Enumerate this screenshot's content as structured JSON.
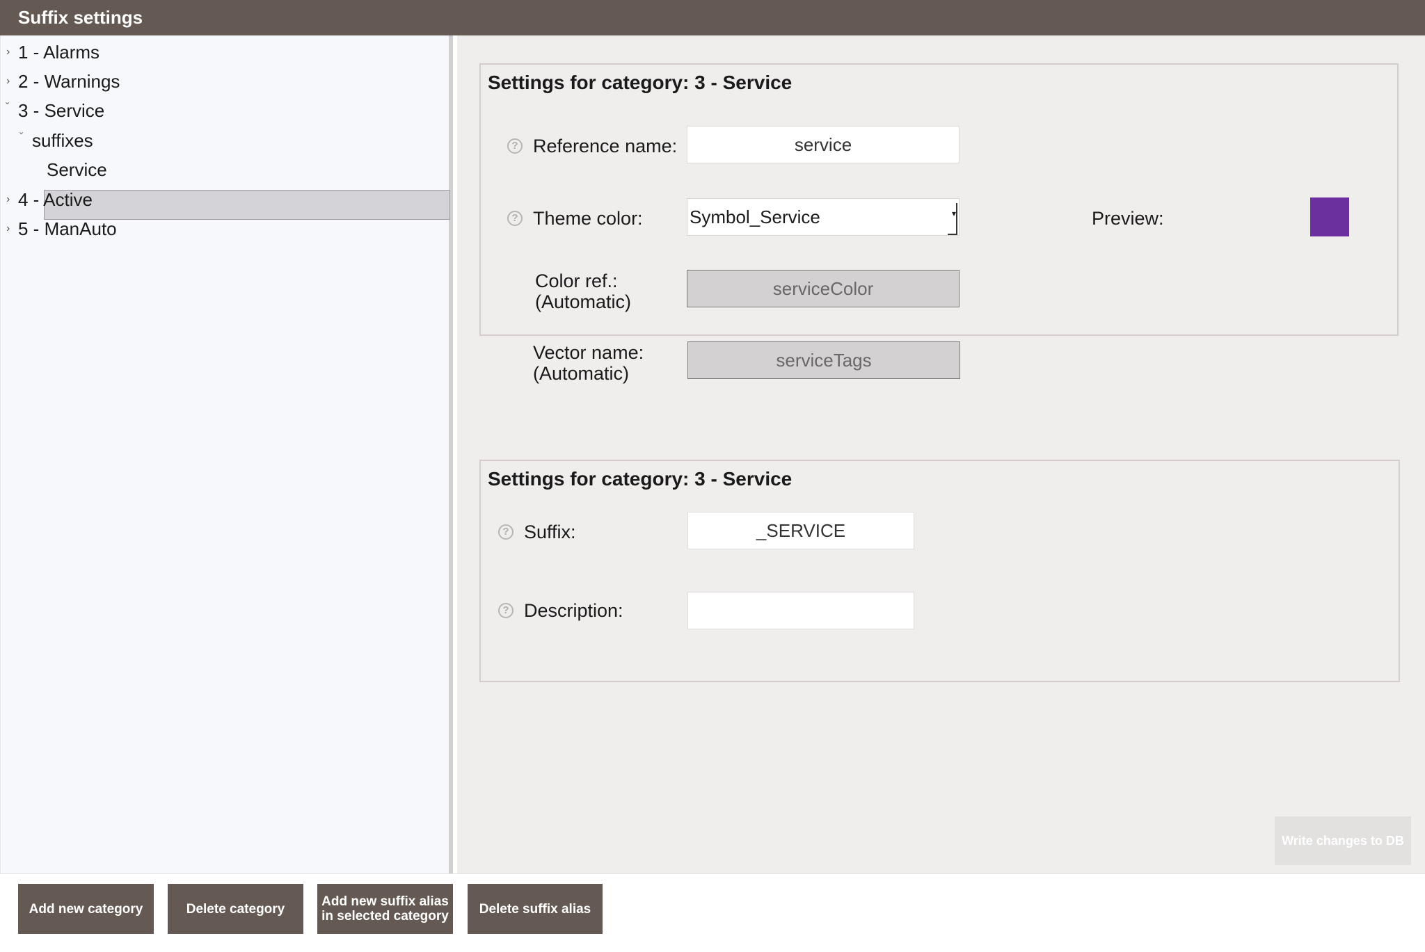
{
  "window": {
    "title": "Suffix settings"
  },
  "tree": {
    "items": [
      {
        "label": "1 - Alarms",
        "expanded": false
      },
      {
        "label": "2 - Warnings",
        "expanded": false
      },
      {
        "label": "3 - Service",
        "expanded": true
      },
      {
        "label": "suffixes",
        "expanded": true
      },
      {
        "label": "Service",
        "selected": true
      },
      {
        "label": "4 - Active",
        "expanded": false
      },
      {
        "label": "5 - ManAuto",
        "expanded": false
      }
    ],
    "collapsed_glyph": "›",
    "expanded_glyph": "ˇ"
  },
  "category_settings": {
    "title": "Settings for category: 3 - Service",
    "reference_name": {
      "label": "Reference name:",
      "value": "service"
    },
    "theme_color": {
      "label": "Theme color:",
      "value": "Symbol_Service"
    },
    "preview": {
      "label": "Preview:",
      "color": "#6b2f9e"
    },
    "color_ref": {
      "label_line1": "Color ref.:",
      "label_line2": "(Automatic)",
      "value": "serviceColor"
    },
    "vector_name": {
      "label_line1": "Vector name:",
      "label_line2": "(Automatic)",
      "value": "serviceTags"
    }
  },
  "suffix_settings": {
    "title": "Settings for category: 3 - Service",
    "suffix": {
      "label": "Suffix:",
      "value": "_SERVICE"
    },
    "description": {
      "label": "Description:",
      "value": ""
    }
  },
  "help_glyph": "?",
  "write_button": {
    "label": "Write changes to DB",
    "enabled": false
  },
  "bottom_buttons": {
    "add_category": "Add new category",
    "delete_category": "Delete category",
    "add_alias_line1": "Add new suffix alias",
    "add_alias_line2": "in selected category",
    "delete_alias": "Delete suffix alias"
  },
  "colors": {
    "titlebar": "#645a53",
    "button": "#645a53",
    "panel": "#f0eded",
    "tree": "#f7f8fc"
  }
}
